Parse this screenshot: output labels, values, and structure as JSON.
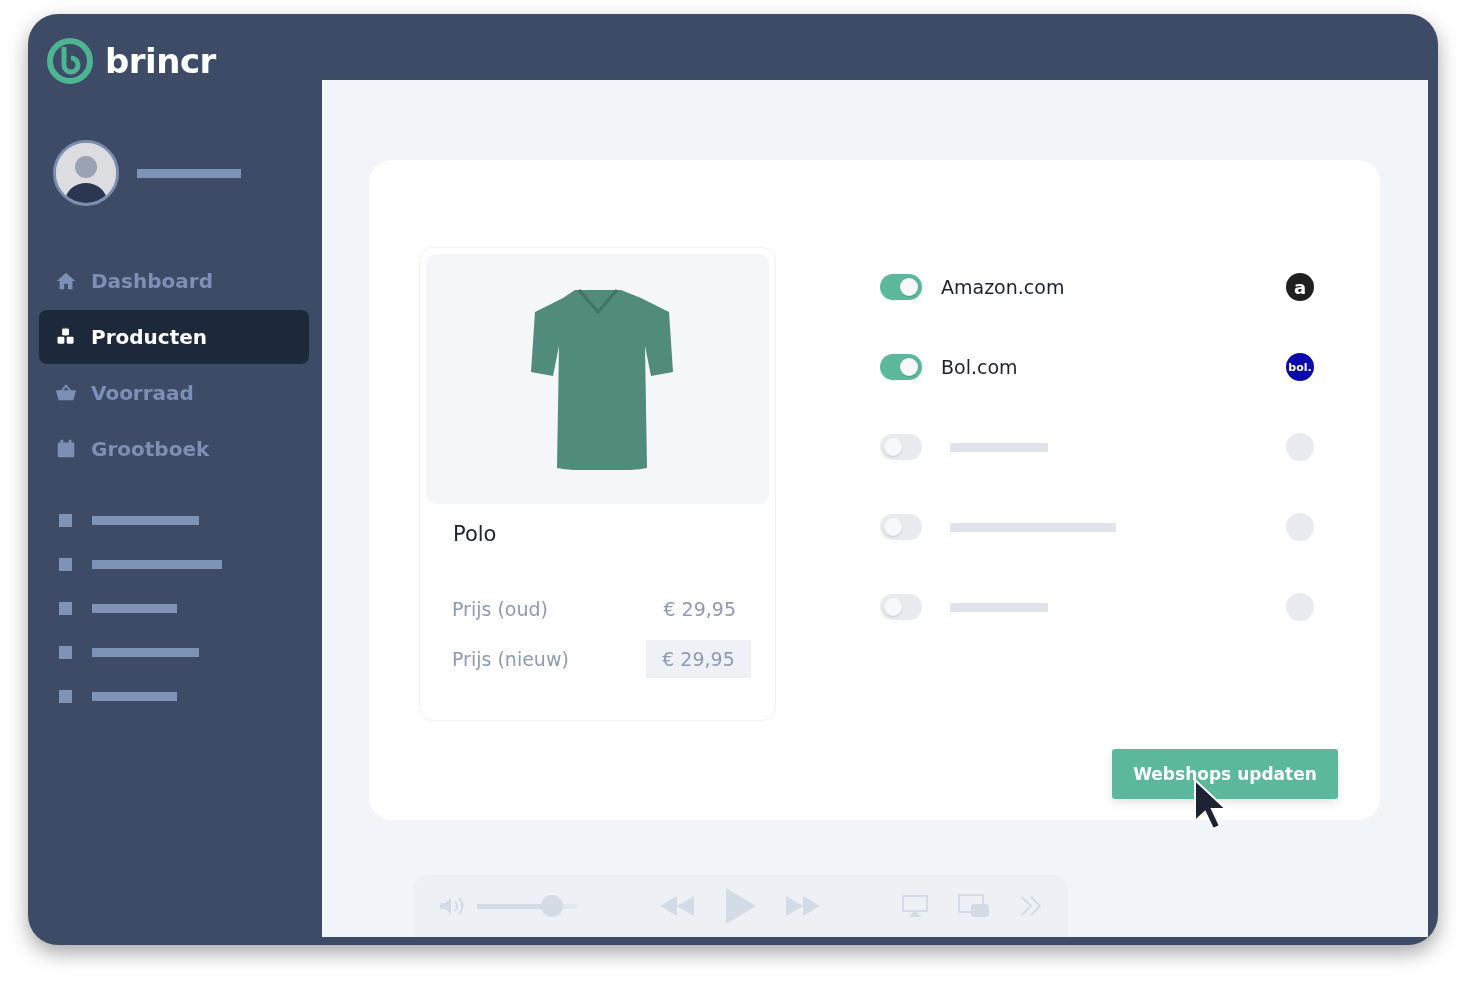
{
  "brand": {
    "name": "brincr"
  },
  "sidebar": {
    "items": [
      {
        "kind": "nav",
        "label": "Dashboard",
        "selected": false
      },
      {
        "kind": "nav",
        "label": "Producten",
        "selected": true
      },
      {
        "kind": "nav",
        "label": "Voorraad",
        "selected": false
      },
      {
        "kind": "nav",
        "label": "Grootboek",
        "selected": false
      },
      {
        "kind": "placeholder"
      },
      {
        "kind": "placeholder"
      },
      {
        "kind": "placeholder"
      },
      {
        "kind": "placeholder"
      },
      {
        "kind": "placeholder"
      }
    ]
  },
  "product": {
    "name": "Polo",
    "prices": [
      {
        "kind": "plain",
        "label": "Prijs (oud)",
        "value": "€ 29,95"
      },
      {
        "kind": "field",
        "label": "Prijs (nieuw)",
        "value": "€ 29,95"
      }
    ]
  },
  "webshops": [
    {
      "kind": "shop",
      "name": "Amazon.com",
      "on": true,
      "logo_text": "a",
      "color": "#1f1f1f"
    },
    {
      "kind": "shop",
      "name": "Bol.com",
      "on": true,
      "logo_text": "bol.",
      "color": "#0a0aa8"
    },
    {
      "kind": "placeholder",
      "on": false
    },
    {
      "kind": "placeholder",
      "on": false
    },
    {
      "kind": "placeholder",
      "on": false
    }
  ],
  "update_button": {
    "label": "Webshops updaten"
  },
  "player": {
    "volume": {
      "level": 0.75
    }
  }
}
